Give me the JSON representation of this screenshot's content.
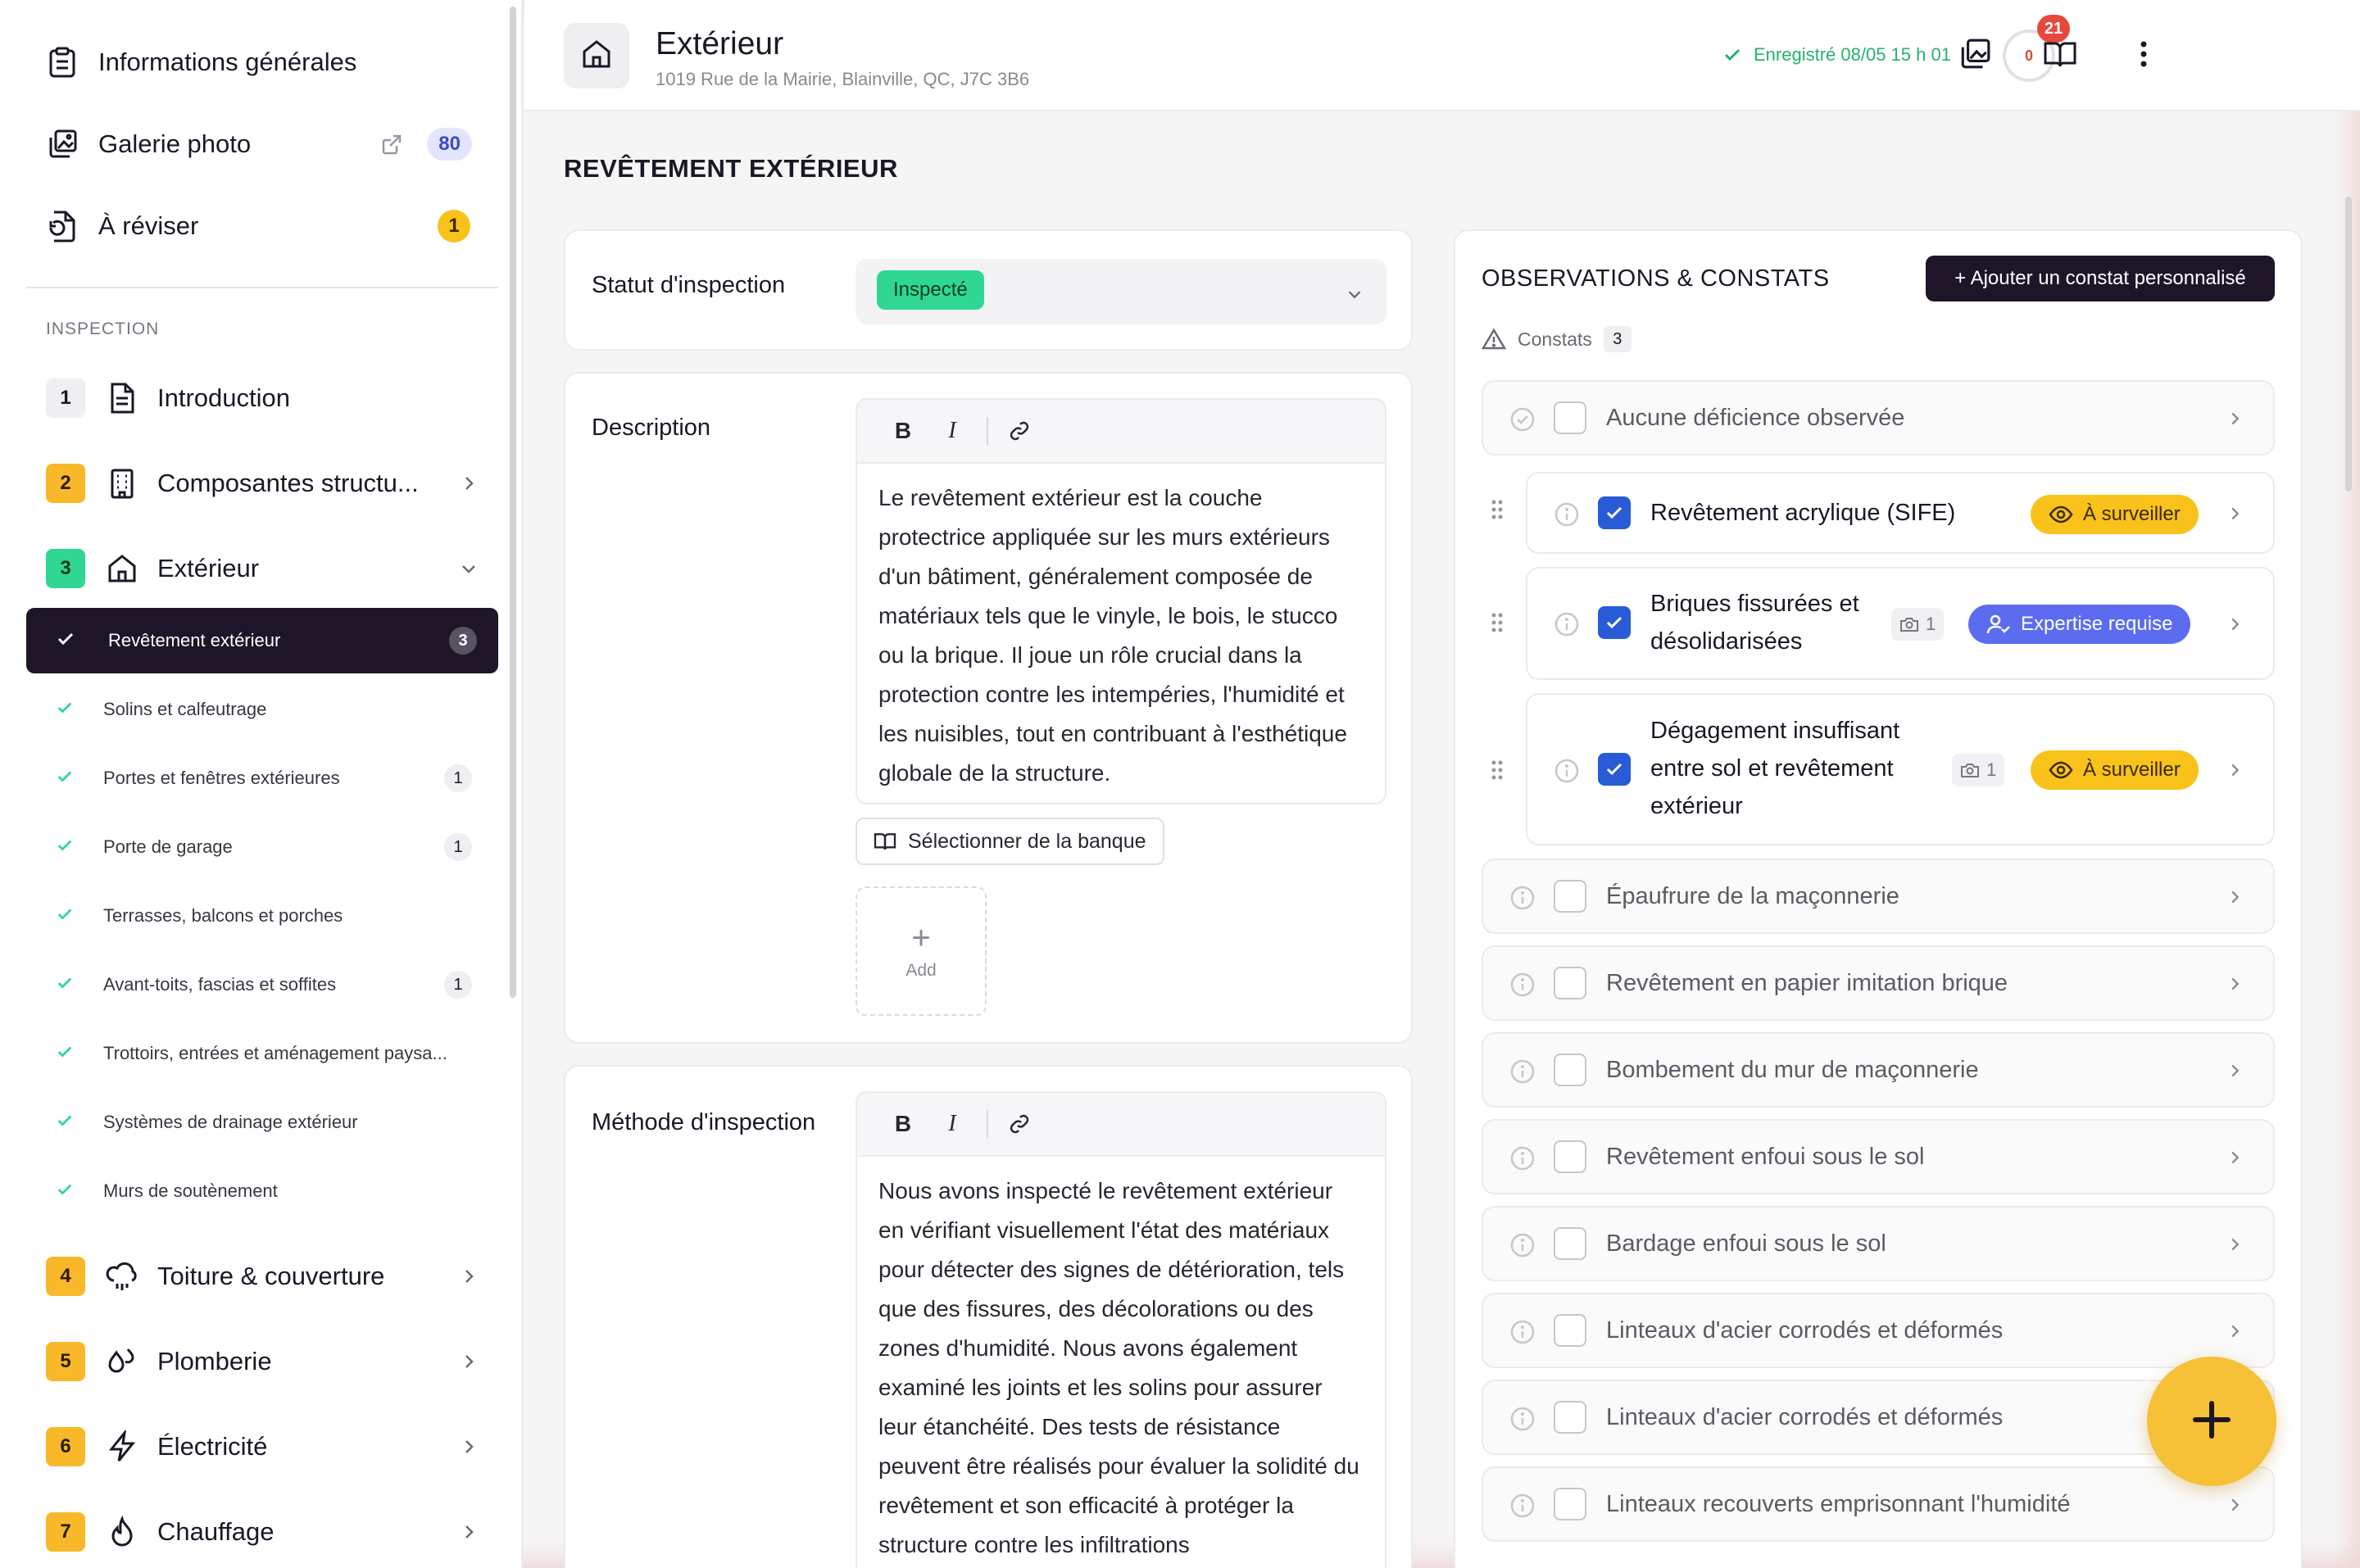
{
  "sidebar": {
    "top_items": [
      {
        "label": "Informations générales",
        "icon": "clipboard-icon"
      },
      {
        "label": "Galerie photo",
        "icon": "gallery-icon",
        "badge": "80"
      },
      {
        "label": "À réviser",
        "icon": "review-icon",
        "badge": "1"
      }
    ],
    "section_label": "INSPECTION",
    "categories": [
      {
        "num": "1",
        "label": "Introduction",
        "icon": "document-icon"
      },
      {
        "num": "2",
        "label": "Composantes structu...",
        "icon": "building-icon"
      },
      {
        "num": "3",
        "label": "Extérieur",
        "icon": "home-icon"
      },
      {
        "num": "4",
        "label": "Toiture & couverture",
        "icon": "rain-cloud-icon"
      },
      {
        "num": "5",
        "label": "Plomberie",
        "icon": "droplet-icon"
      },
      {
        "num": "6",
        "label": "Électricité",
        "icon": "lightning-icon"
      },
      {
        "num": "7",
        "label": "Chauffage",
        "icon": "flame-icon"
      }
    ],
    "subitems": [
      {
        "label": "Revêtement extérieur",
        "count": "3"
      },
      {
        "label": "Solins et calfeutrage",
        "count": ""
      },
      {
        "label": "Portes et fenêtres extérieures",
        "count": "1"
      },
      {
        "label": "Porte de garage",
        "count": "1"
      },
      {
        "label": "Terrasses, balcons et porches",
        "count": ""
      },
      {
        "label": "Avant-toits, fascias et soffites",
        "count": "1"
      },
      {
        "label": "Trottoirs, entrées et aménagement paysa...",
        "count": ""
      },
      {
        "label": "Systèmes de drainage extérieur",
        "count": ""
      },
      {
        "label": "Murs de soutènement",
        "count": ""
      }
    ]
  },
  "header": {
    "title": "Extérieur",
    "address": "1019 Rue de la Mairie, Blainville, QC, J7C 3B6",
    "saved": "Enregistré 08/05 15 h 01",
    "progress": "0",
    "notifications": "21"
  },
  "main": {
    "page_title": "REVÊTEMENT EXTÉRIEUR",
    "status_label": "Statut d'inspection",
    "status_value": "Inspecté",
    "description_label": "Description",
    "description_text": "Le revêtement extérieur est la couche protectrice appliquée sur les murs extérieurs d'un bâtiment, généralement composée de matériaux tels que le vinyle, le bois, le stucco ou la brique. Il joue un rôle crucial dans la protection contre les intempéries, l'humidité et les nuisibles, tout en contribuant à l'esthétique globale de la structure.",
    "bank_button": "Sélectionner de la banque",
    "add_label": "Add",
    "method_label": "Méthode d'inspection",
    "method_text": "Nous avons inspecté le revêtement extérieur en vérifiant visuellement l'état des matériaux pour détecter des signes de détérioration, tels que des fissures, des décolorations ou des zones d'humidité. Nous avons également examiné les joints et les solins pour assurer leur étanchéité. Des tests de résistance peuvent être réalisés pour évaluer la solidité du revêtement et son efficacité à protéger la structure contre les infiltrations"
  },
  "observations": {
    "title": "OBSERVATIONS & CONSTATS",
    "add_button": "+ Ajouter un constat personnalisé",
    "constats_label": "Constats",
    "constats_count": "3",
    "rows": [
      {
        "label": "Aucune déficience observée",
        "checked": false
      },
      {
        "label": "Revêtement acrylique (SIFE)",
        "checked": true,
        "tag": "À surveiller"
      },
      {
        "label": "Briques fissurées et désolidarisées",
        "checked": true,
        "tag": "Expertise requise",
        "photos": "1"
      },
      {
        "label": "Dégagement insuffisant entre sol et revêtement extérieur",
        "checked": true,
        "tag": "À surveiller",
        "photos": "1"
      },
      {
        "label": "Épaufrure de la maçonnerie",
        "checked": false
      },
      {
        "label": "Revêtement en papier imitation brique",
        "checked": false
      },
      {
        "label": "Bombement du mur de maçonnerie",
        "checked": false
      },
      {
        "label": "Revêtement enfoui sous le sol",
        "checked": false
      },
      {
        "label": "Bardage enfoui sous le sol",
        "checked": false
      },
      {
        "label": "Linteaux d'acier corrodés et déformés",
        "checked": false
      },
      {
        "label": "Linteaux d'acier corrodés et déformés",
        "checked": false
      },
      {
        "label": "Linteaux recouverts emprisonnant l'humidité",
        "checked": false
      }
    ]
  },
  "colors": {
    "accent_dark": "#1e1628",
    "status_green": "#2fd793",
    "warning_yellow": "#f8c21a",
    "expert_blue": "#5b6cf0",
    "checkbox_blue": "#2a5bd7",
    "fab_yellow": "#f6c037"
  }
}
